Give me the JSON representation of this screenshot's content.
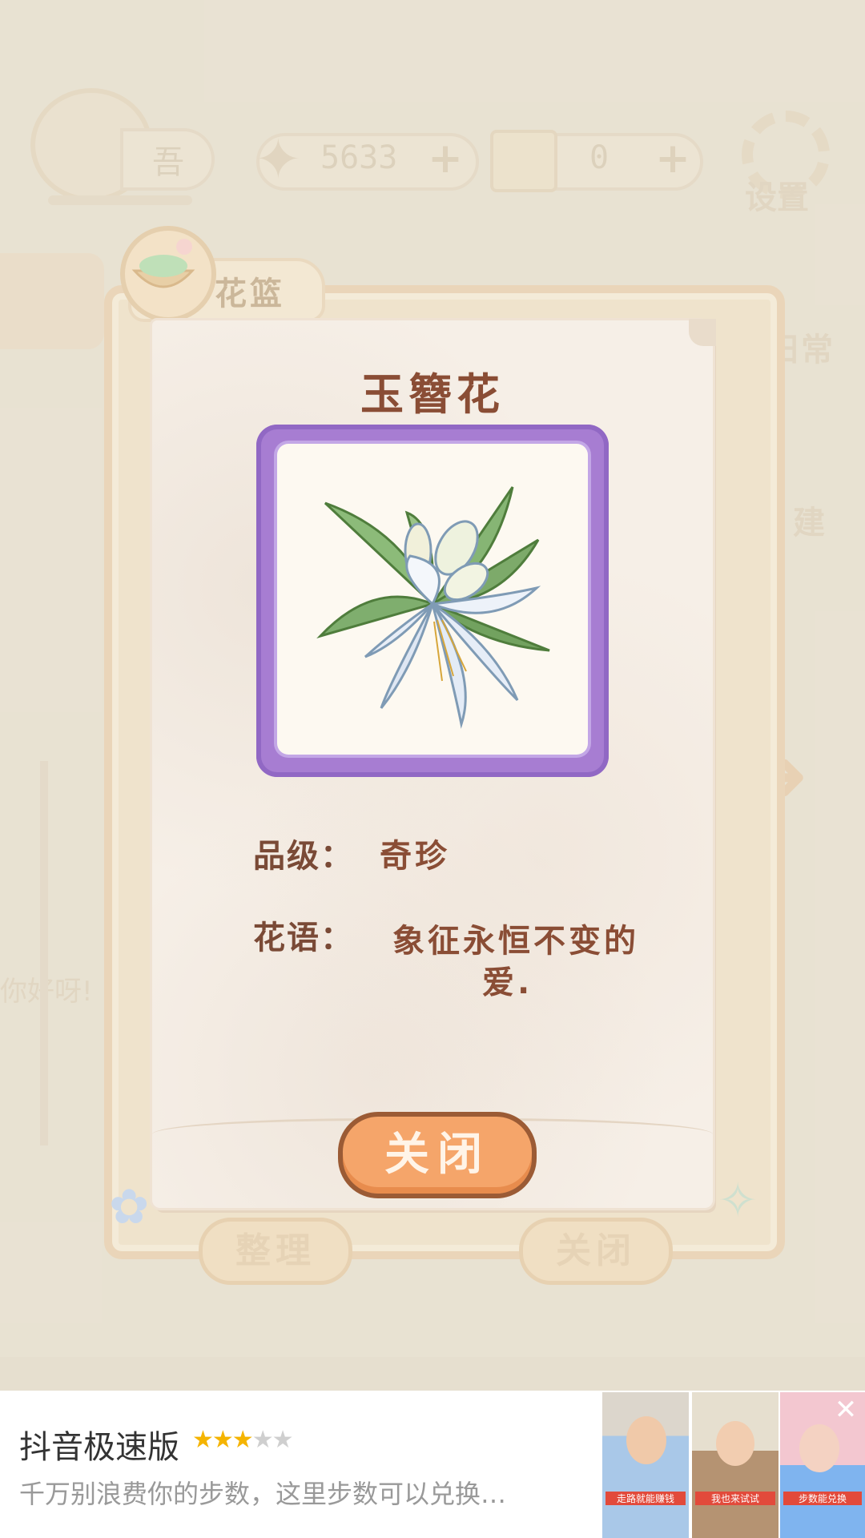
{
  "hud": {
    "fish_count": "5633",
    "cheese_count": "0",
    "settings_label": "设置",
    "level_glyph": "吾"
  },
  "side": {
    "daily_label": "日常",
    "build_label": "建",
    "greeting": "你好呀!"
  },
  "basket": {
    "tab_label": "花篮",
    "sort_button": "整理",
    "close_button": "关闭"
  },
  "flower_card": {
    "name": "玉簪花",
    "grade_label": "品级：",
    "grade_value": "奇珍",
    "meaning_label": "花语：",
    "meaning_line1": "象征永恒不变的",
    "meaning_line2": "爱.",
    "close_button": "关闭",
    "frame_color": "#a77dd2"
  },
  "ad": {
    "title": "抖音极速版",
    "rating": 3,
    "rating_max": 5,
    "stars_filled": "★★★",
    "stars_empty": "★★",
    "description": "千万别浪费你的步数，这里步数可以兑换…",
    "thumb1_caption": "走路就能赚钱",
    "thumb2_caption": "我也来试试",
    "thumb3_caption": "步数能兑换"
  }
}
